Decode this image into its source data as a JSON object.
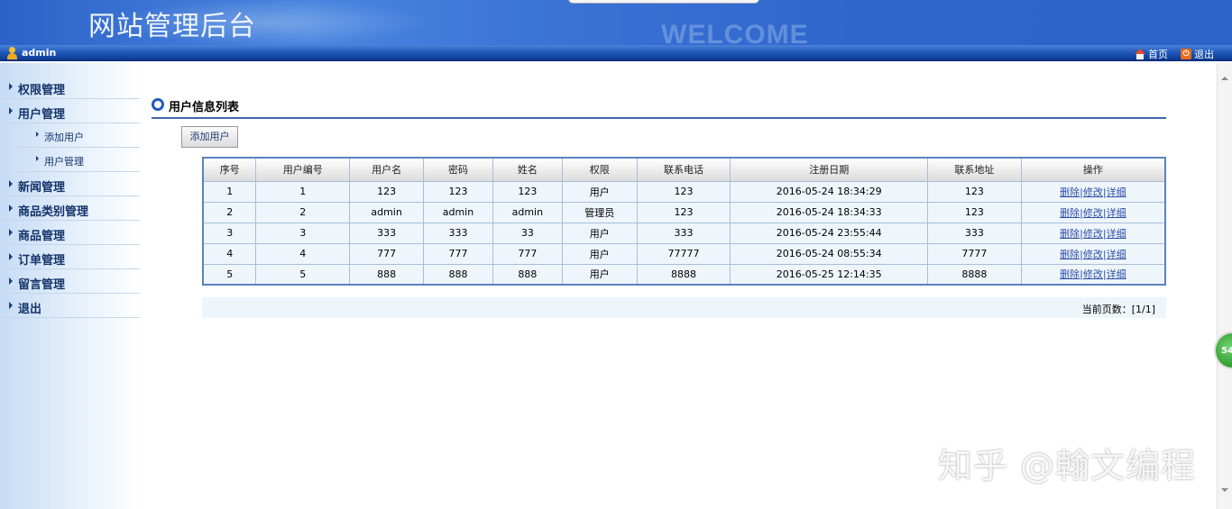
{
  "header": {
    "title": "网站管理后台",
    "welcome": "WELCOME"
  },
  "userbar": {
    "username": "admin",
    "nav": [
      {
        "label": "首页",
        "icon": "home-icon"
      },
      {
        "label": "退出",
        "icon": "power-icon"
      }
    ]
  },
  "sidebar": {
    "items": [
      {
        "label": "权限管理"
      },
      {
        "label": "用户管理"
      },
      {
        "label": "添加用户",
        "sub": true
      },
      {
        "label": "用户管理",
        "sub": true
      },
      {
        "label": "新闻管理"
      },
      {
        "label": "商品类别管理"
      },
      {
        "label": "商品管理"
      },
      {
        "label": "订单管理"
      },
      {
        "label": "留言管理"
      },
      {
        "label": "退出"
      }
    ]
  },
  "main": {
    "section_title": "用户信息列表",
    "add_button": "添加用户",
    "table": {
      "columns": [
        "序号",
        "用户编号",
        "用户名",
        "密码",
        "姓名",
        "权限",
        "联系电话",
        "注册日期",
        "联系地址",
        "操作"
      ],
      "rows": [
        [
          "1",
          "1",
          "123",
          "123",
          "123",
          "用户",
          "123",
          "2016-05-24 18:34:29",
          "123"
        ],
        [
          "2",
          "2",
          "admin",
          "admin",
          "admin",
          "管理员",
          "123",
          "2016-05-24 18:34:33",
          "123"
        ],
        [
          "3",
          "3",
          "333",
          "333",
          "33",
          "用户",
          "333",
          "2016-05-24 23:55:44",
          "333"
        ],
        [
          "4",
          "4",
          "777",
          "777",
          "777",
          "用户",
          "77777",
          "2016-05-24 08:55:34",
          "7777"
        ],
        [
          "5",
          "5",
          "888",
          "888",
          "888",
          "用户",
          "8888",
          "2016-05-25 12:14:35",
          "8888"
        ]
      ],
      "actions": [
        "删除",
        "修改",
        "详细"
      ]
    },
    "pager": "当前页数：[1/1]"
  },
  "float_badge": "54",
  "watermark": "知乎 @翰文编程",
  "colors": {
    "banner": "#2c62c8",
    "userbar": "#1d56b8",
    "table_border": "#5b82bf",
    "link": "#2b4ea8"
  }
}
